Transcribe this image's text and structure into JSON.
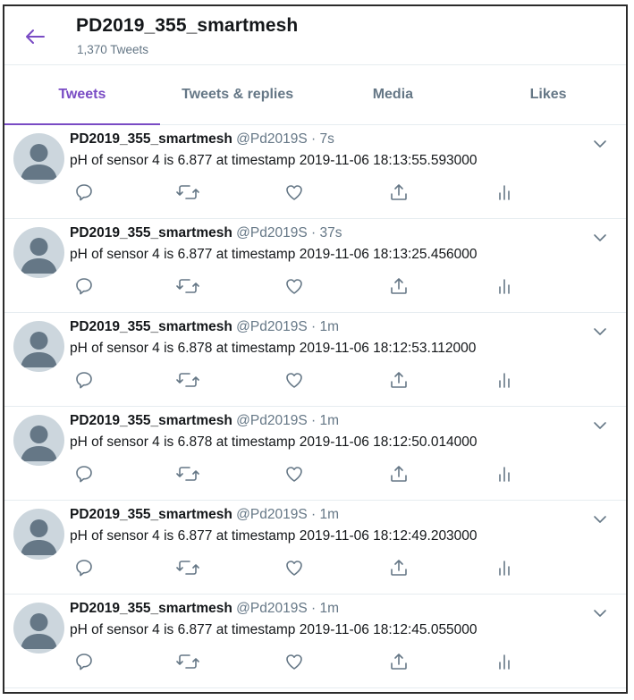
{
  "profile": {
    "name": "PD2019_355_smartmesh",
    "tweet_count": "1,370 Tweets"
  },
  "tabs": [
    {
      "label": "Tweets",
      "active": true
    },
    {
      "label": "Tweets & replies",
      "active": false
    },
    {
      "label": "Media",
      "active": false
    },
    {
      "label": "Likes",
      "active": false
    }
  ],
  "accent_color": "#794bc4",
  "tweets": [
    {
      "name": "PD2019_355_smartmesh",
      "handle": "@Pd2019S",
      "dot": "·",
      "time": "7s",
      "text": "pH of sensor 4 is 6.877 at timestamp 2019-11-06 18:13:55.593000"
    },
    {
      "name": "PD2019_355_smartmesh",
      "handle": "@Pd2019S",
      "dot": "·",
      "time": "37s",
      "text": "pH of sensor 4 is 6.877 at timestamp 2019-11-06 18:13:25.456000"
    },
    {
      "name": "PD2019_355_smartmesh",
      "handle": "@Pd2019S",
      "dot": "·",
      "time": "1m",
      "text": "pH of sensor 4 is 6.878 at timestamp 2019-11-06 18:12:53.112000"
    },
    {
      "name": "PD2019_355_smartmesh",
      "handle": "@Pd2019S",
      "dot": "·",
      "time": "1m",
      "text": "pH of sensor 4 is 6.878 at timestamp 2019-11-06 18:12:50.014000"
    },
    {
      "name": "PD2019_355_smartmesh",
      "handle": "@Pd2019S",
      "dot": "·",
      "time": "1m",
      "text": "pH of sensor 4 is 6.877 at timestamp 2019-11-06 18:12:49.203000"
    },
    {
      "name": "PD2019_355_smartmesh",
      "handle": "@Pd2019S",
      "dot": "·",
      "time": "1m",
      "text": "pH of sensor 4 is 6.877 at timestamp 2019-11-06 18:12:45.055000"
    }
  ],
  "icons": {
    "back": "arrow-left-icon",
    "menu": "chevron-down-icon",
    "actions": [
      "reply-icon",
      "retweet-icon",
      "like-icon",
      "share-icon",
      "analytics-icon"
    ]
  }
}
